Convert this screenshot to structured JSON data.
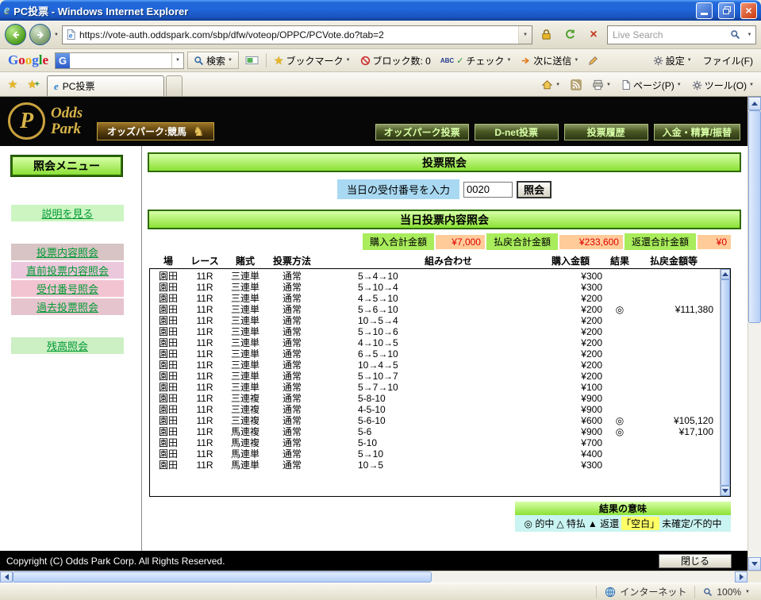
{
  "titlebar": {
    "title": "PC投票 - Windows Internet Explorer"
  },
  "address": {
    "url": "https://vote-auth.oddspark.com/sbp/dfw/voteop/OPPC/PCVote.do?tab=2",
    "search_placeholder": "Live Search"
  },
  "google_bar": {
    "logo": "Google",
    "search_button": "検索",
    "bookmarks_label": "ブックマーク",
    "block_label": "ブロック数: 0",
    "check_label": "チェック",
    "send_label": "次に送信",
    "settings_label": "設定",
    "file_label": "ファイル(F)"
  },
  "tab_bar": {
    "tab_title": "PC投票",
    "page_label": "ページ(P)",
    "tools_label": "ツール(O)"
  },
  "banner": {
    "logo_letter": "P",
    "brand_top": "Odds",
    "brand_bottom": "Park",
    "keiba_label": "オッズパーク:競馬",
    "nav_buttons": [
      "オッズパーク投票",
      "D-net投票",
      "投票履歴",
      "入金・精算/振替"
    ]
  },
  "sidebar": {
    "title": "照会メニュー",
    "items": [
      {
        "label": "説明を見る",
        "bg": "#CCF5C2",
        "group": "top"
      },
      {
        "label": "投票内容照会",
        "bg": "#D8C4C4",
        "group": "mid"
      },
      {
        "label": "直前投票内容照会",
        "bg": "#ECC8DC",
        "group": "mid"
      },
      {
        "label": "受付番号照会",
        "bg": "#F2C4D2",
        "group": "mid"
      },
      {
        "label": "過去投票照会",
        "bg": "#E6C4CE",
        "group": "mid"
      },
      {
        "label": "残高照会",
        "bg": "#CCEFC4",
        "group": "bottom"
      }
    ]
  },
  "inquiry": {
    "title": "投票照会",
    "input_label": "当日の受付番号を入力",
    "receipt_number": "0020",
    "submit_label": "照会"
  },
  "today": {
    "title": "当日投票内容照会",
    "totals": [
      {
        "label": "購入合計金額",
        "value": "¥7,000"
      },
      {
        "label": "払戻合計金額",
        "value": "¥233,600"
      },
      {
        "label": "返還合計金額",
        "value": "¥0"
      }
    ],
    "columns": [
      "場",
      "レース",
      "賭式",
      "投票方法",
      "組み合わせ",
      "購入金額",
      "結果",
      "払戻金額等"
    ],
    "rows": [
      [
        "園田",
        "11R",
        "三連単",
        "通常",
        "5→4→10",
        "¥300",
        "",
        ""
      ],
      [
        "園田",
        "11R",
        "三連単",
        "通常",
        "5→10→4",
        "¥300",
        "",
        ""
      ],
      [
        "園田",
        "11R",
        "三連単",
        "通常",
        "4→5→10",
        "¥200",
        "",
        ""
      ],
      [
        "園田",
        "11R",
        "三連単",
        "通常",
        "5→6→10",
        "¥200",
        "◎",
        "¥111,380"
      ],
      [
        "園田",
        "11R",
        "三連単",
        "通常",
        "10→5→4",
        "¥200",
        "",
        ""
      ],
      [
        "園田",
        "11R",
        "三連単",
        "通常",
        "5→10→6",
        "¥200",
        "",
        ""
      ],
      [
        "園田",
        "11R",
        "三連単",
        "通常",
        "4→10→5",
        "¥200",
        "",
        ""
      ],
      [
        "園田",
        "11R",
        "三連単",
        "通常",
        "6→5→10",
        "¥200",
        "",
        ""
      ],
      [
        "園田",
        "11R",
        "三連単",
        "通常",
        "10→4→5",
        "¥200",
        "",
        ""
      ],
      [
        "園田",
        "11R",
        "三連単",
        "通常",
        "5→10→7",
        "¥200",
        "",
        ""
      ],
      [
        "園田",
        "11R",
        "三連単",
        "通常",
        "5→7→10",
        "¥100",
        "",
        ""
      ],
      [
        "園田",
        "11R",
        "三連複",
        "通常",
        "5-8-10",
        "¥900",
        "",
        ""
      ],
      [
        "園田",
        "11R",
        "三連複",
        "通常",
        "4-5-10",
        "¥900",
        "",
        ""
      ],
      [
        "園田",
        "11R",
        "三連複",
        "通常",
        "5-6-10",
        "¥600",
        "◎",
        "¥105,120"
      ],
      [
        "園田",
        "11R",
        "馬連複",
        "通常",
        "5-6",
        "¥900",
        "◎",
        "¥17,100"
      ],
      [
        "園田",
        "11R",
        "馬連複",
        "通常",
        "5-10",
        "¥700",
        "",
        ""
      ],
      [
        "園田",
        "11R",
        "馬連単",
        "通常",
        "5→10",
        "¥400",
        "",
        ""
      ],
      [
        "園田",
        "11R",
        "馬連単",
        "通常",
        "10→5",
        "¥300",
        "",
        ""
      ]
    ],
    "legend_title": "結果の意味",
    "legend_parts": [
      {
        "text": "◎ 的中"
      },
      {
        "text": "△ 特払"
      },
      {
        "text": "▲ 返還"
      },
      {
        "text": "「空白」",
        "highlight": true
      },
      {
        "text": "未確定/不的中"
      }
    ]
  },
  "footer": {
    "copyright": "Copyright (C) Odds Park Corp. All Rights Reserved.",
    "close_label": "閉じる"
  },
  "statusbar": {
    "zone": "インターネット",
    "zoom": "100%"
  },
  "colors": {
    "header_green_top": "#D8FFA8",
    "header_green_bottom": "#8BE136",
    "header_border": "#2E6B00",
    "total_label_bg": "#A9EC5C",
    "total_value_bg": "#FFCC99",
    "total_value_text": "#E00000",
    "legend_body_bg": "#C9F4F2",
    "highlight_bg": "#FFFF66"
  }
}
